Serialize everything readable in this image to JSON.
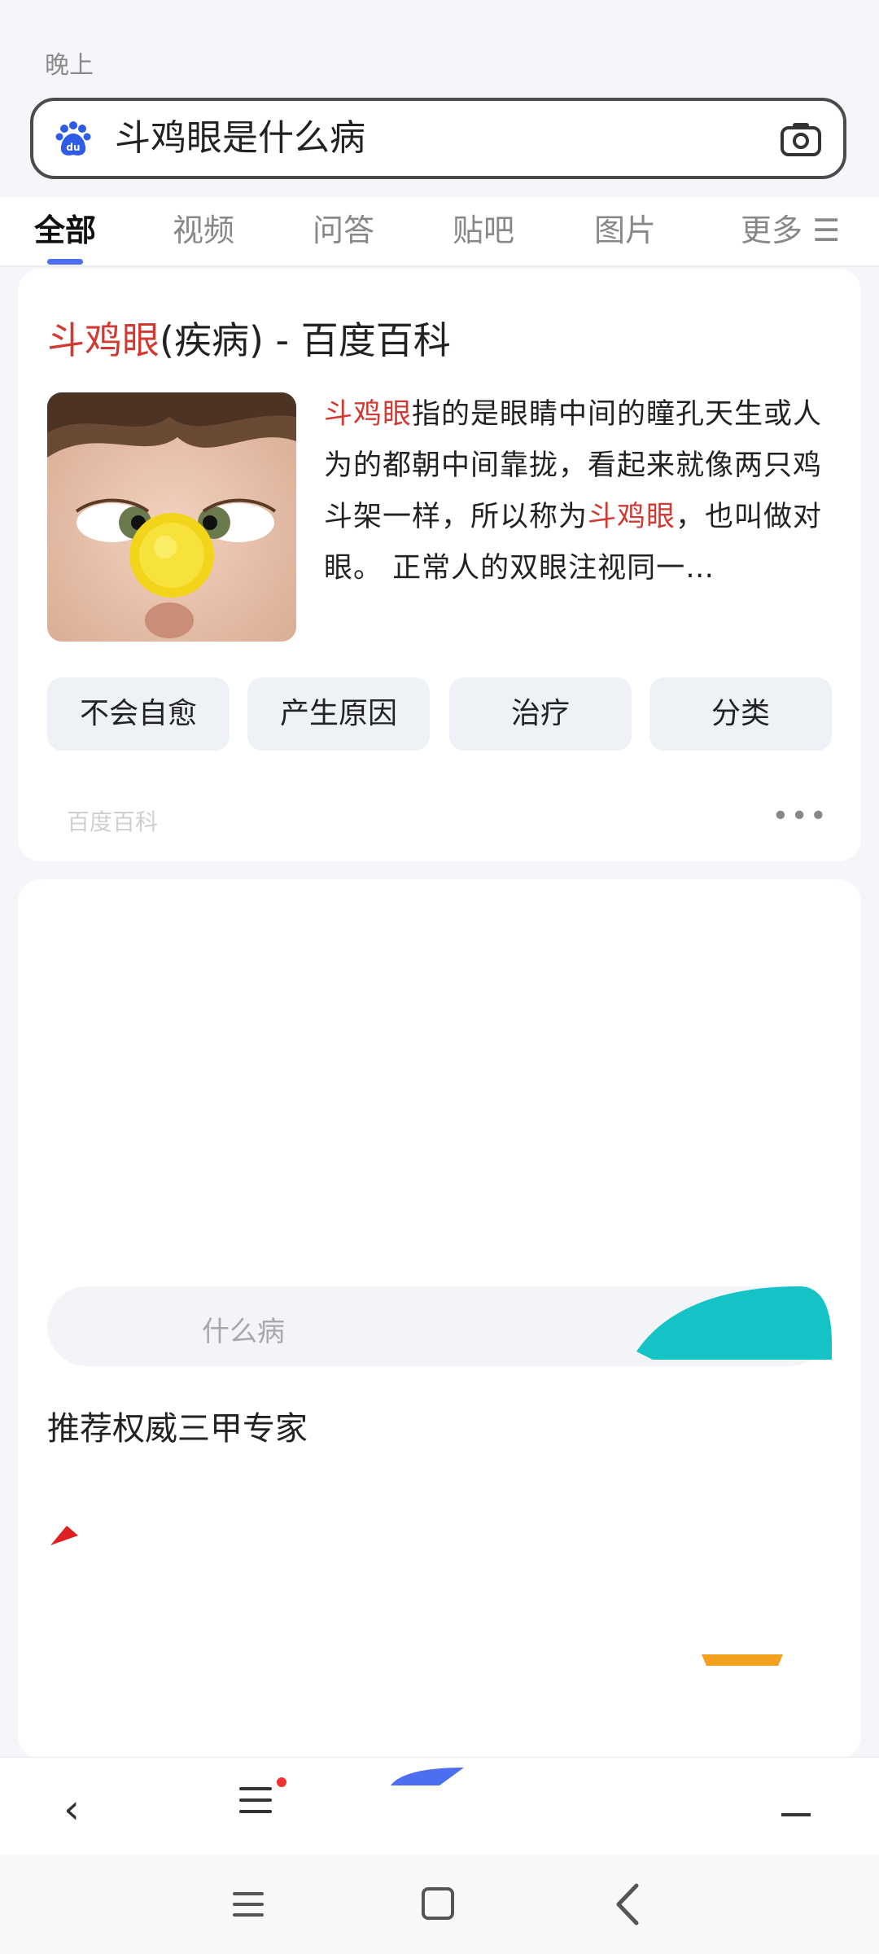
{
  "status_fragment": "晚上",
  "search": {
    "query": "斗鸡眼是什么病"
  },
  "tabs": [
    {
      "label": "全部",
      "active": true
    },
    {
      "label": "视频",
      "active": false
    },
    {
      "label": "问答",
      "active": false
    },
    {
      "label": "贴吧",
      "active": false
    },
    {
      "label": "图片",
      "active": false
    },
    {
      "label": "更多 ☰",
      "active": false
    }
  ],
  "baike": {
    "title_highlight": "斗鸡眼",
    "title_rest": "(疾病) - 百度百科",
    "desc_hl1": "斗鸡眼",
    "desc_part1": "指的是眼睛中间的瞳孔天生或人为的都朝中间靠拢，看起来就像两只鸡斗架一样，所以称为",
    "desc_hl2": "斗鸡眼",
    "desc_part2": "，也叫做对眼。 正常人的双眼注视同一…",
    "chips": [
      "不会自愈",
      "产生原因",
      "治疗",
      "分类"
    ],
    "source_fragment": "百度百科",
    "more": "•••"
  },
  "card2": {
    "pill_text": "什么病",
    "expert_heading": "推荐权威三甲专家"
  },
  "nav": {
    "back": "‹"
  },
  "colors": {
    "accent": "#4e6ef2",
    "highlight": "#d13a32",
    "teal": "#14c3c6"
  },
  "icons": [
    "baidu-paw-icon",
    "camera-icon",
    "more-dots-icon",
    "back-arrow-icon",
    "menu-icon"
  ]
}
